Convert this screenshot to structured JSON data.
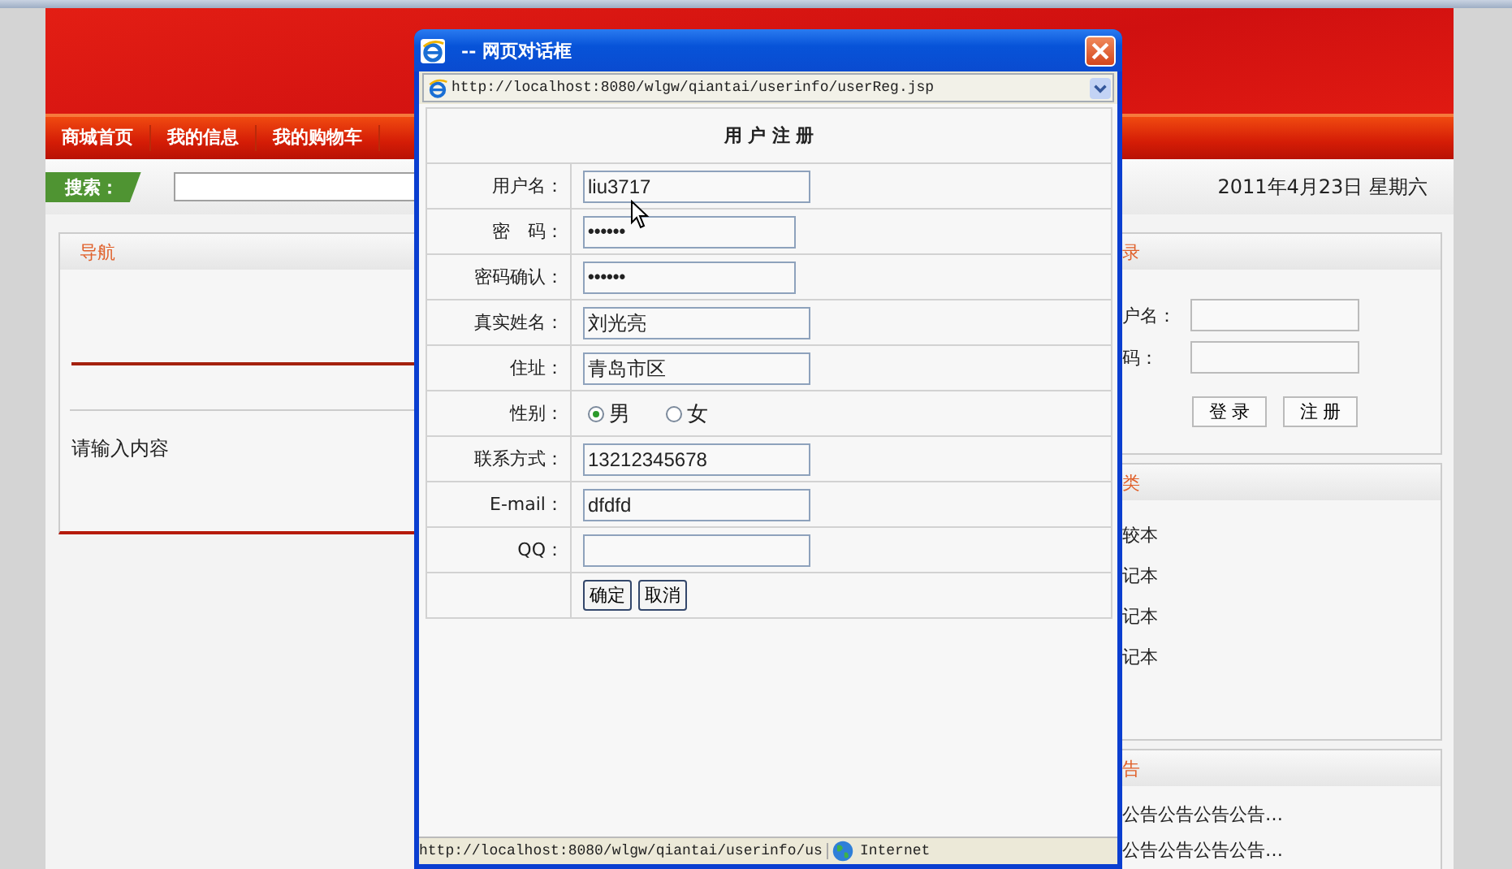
{
  "page": {
    "nav": [
      "商城首页",
      "我的信息",
      "我的购物车"
    ],
    "search": {
      "label": "搜索："
    },
    "date": "2011年4月23日 星期六",
    "left_panel": {
      "title": "导航",
      "text": "请输入内容"
    },
    "login_panel": {
      "title": "录",
      "fields": [
        {
          "label": "户名："
        },
        {
          "label": "码："
        }
      ],
      "buttons": [
        "登 录",
        "注 册"
      ]
    },
    "category_panel": {
      "title": "类",
      "items": [
        "较本",
        "记本",
        "记本",
        "记本"
      ]
    },
    "notice_panel": {
      "title": "告",
      "items": [
        "公告公告公告公告…",
        "公告公告公告公告…"
      ]
    }
  },
  "dialog": {
    "title": "-- 网页对话框",
    "url": "http://localhost:8080/wlgw/qiantai/userinfo/userReg.jsp",
    "form_title": "用 户 注 册",
    "fields": [
      {
        "kind": "text",
        "label": "用户名：",
        "value": "liu3717"
      },
      {
        "kind": "password",
        "label": "密　码：",
        "value": "••••••"
      },
      {
        "kind": "password",
        "label": "密码确认：",
        "value": "••••••"
      },
      {
        "kind": "text",
        "label": "真实姓名：",
        "value": "刘光亮"
      },
      {
        "kind": "text",
        "label": "住址：",
        "value": "青岛市区"
      },
      {
        "kind": "radio",
        "label": "性别：",
        "options": [
          {
            "label": "男",
            "selected": true
          },
          {
            "label": "女",
            "selected": false
          }
        ]
      },
      {
        "kind": "text",
        "label": "联系方式：",
        "value": "13212345678"
      },
      {
        "kind": "text",
        "label": "E-mail：",
        "value": "dfdfd"
      },
      {
        "kind": "text",
        "label": "QQ："
      }
    ],
    "buttons": [
      "确定",
      "取消"
    ],
    "status_url": "http://localhost:8080/wlgw/qiantai/userinfo/us",
    "zone": "Internet"
  }
}
